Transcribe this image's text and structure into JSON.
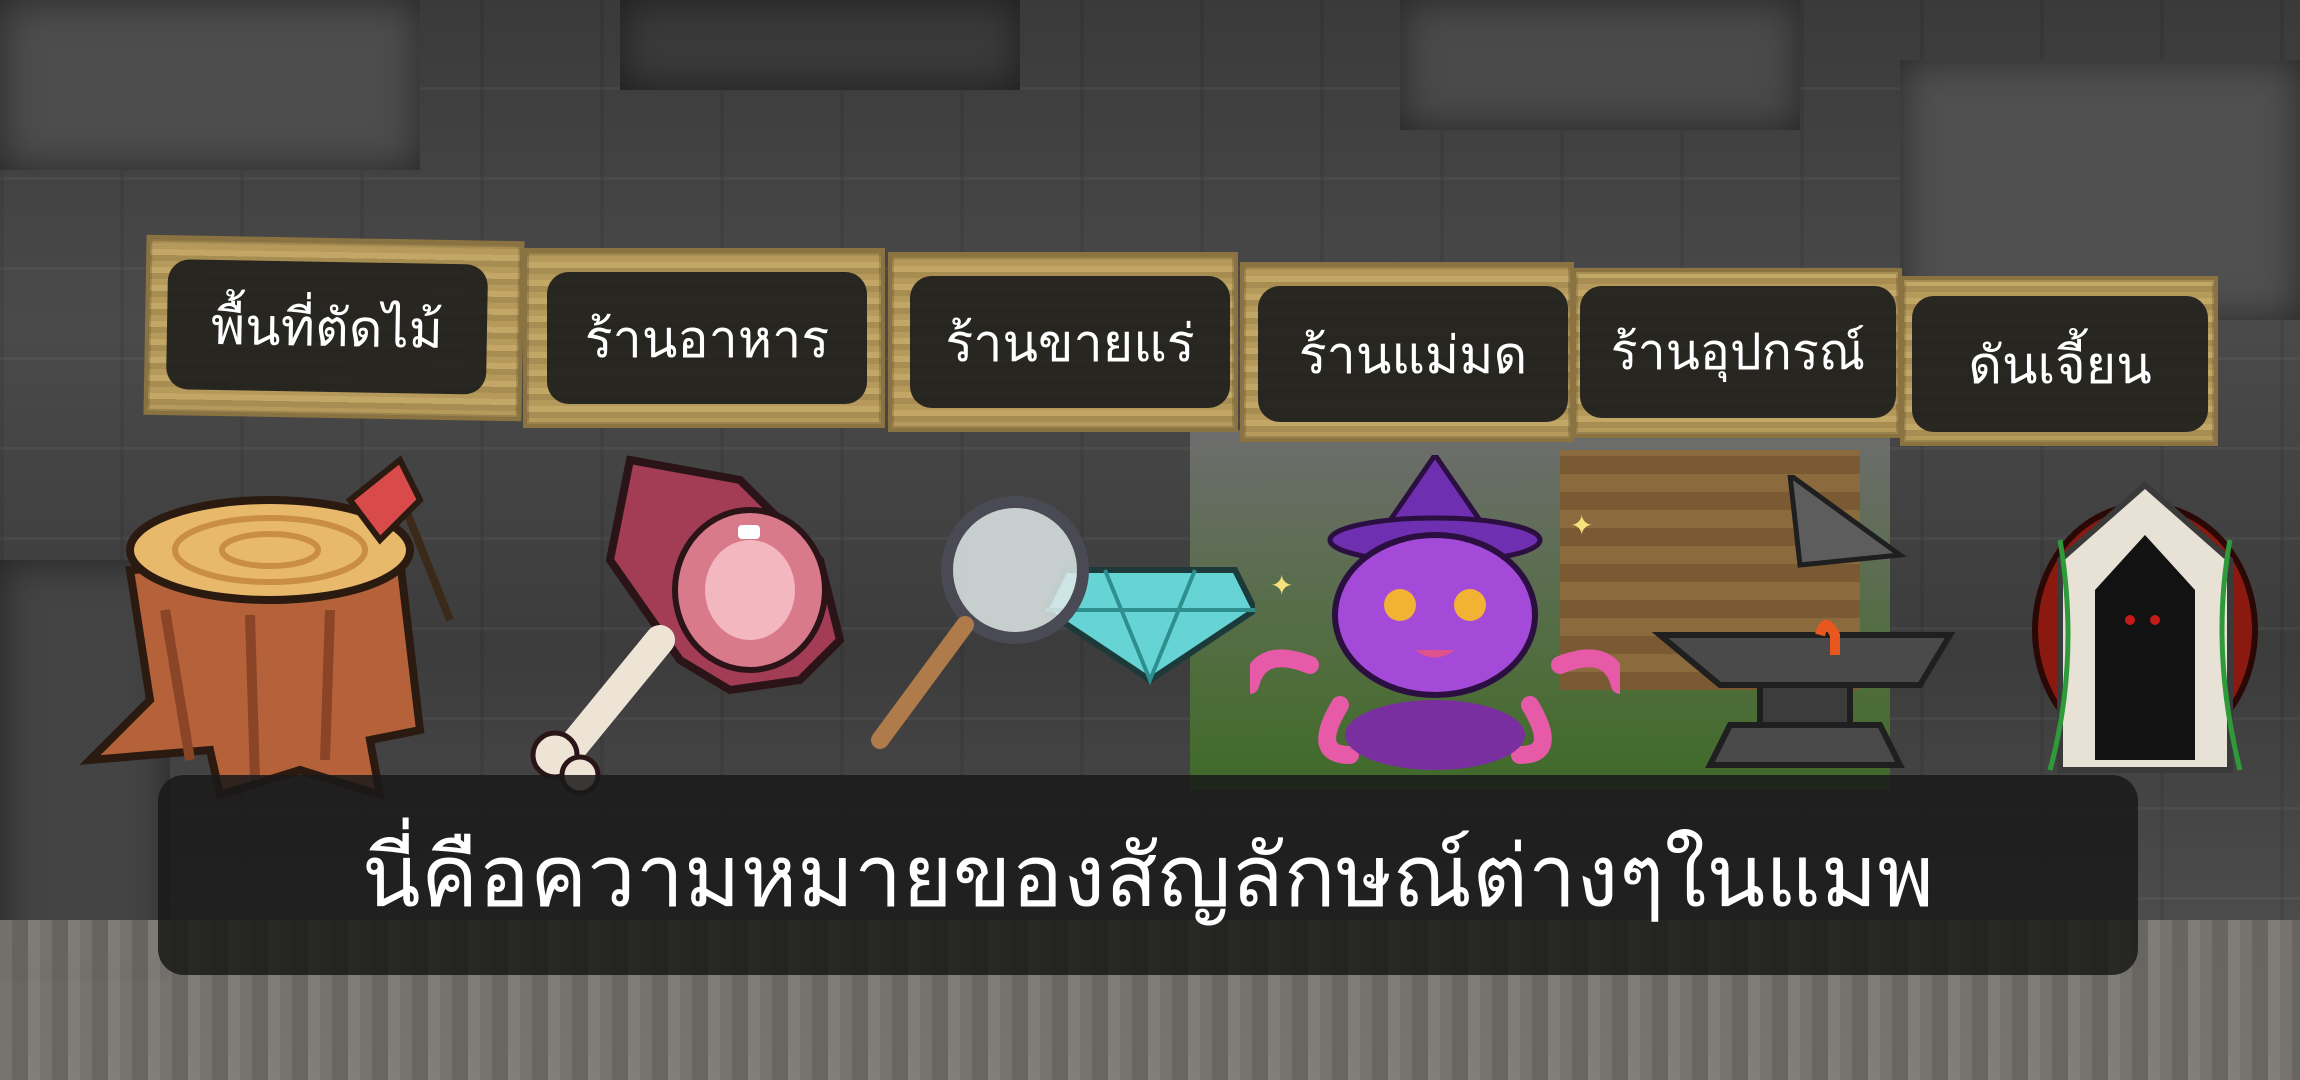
{
  "signs": [
    {
      "label": "พื้นที่ตัดไม้"
    },
    {
      "label": "ร้านอาหาร"
    },
    {
      "label": "ร้านขายแร่"
    },
    {
      "label": "ร้านแม่มด"
    },
    {
      "label": "ร้านอุปกรณ์"
    },
    {
      "label": "ดันเจี้ยน"
    }
  ],
  "icons": [
    "tree-stump-axe-icon",
    "meat-leg-icon",
    "magnifier-diamond-icon",
    "witch-cat-icon",
    "anvil-icon",
    "dungeon-portal-icon"
  ],
  "caption": {
    "text": "นี่คือความหมายของสัญลักษณ์ต่างๆในแมพ"
  },
  "colors": {
    "label_bg": "#1c1c1c",
    "label_text": "#ffffff",
    "sign_wood": "#b59a5b",
    "caption_bg": "#191919"
  }
}
